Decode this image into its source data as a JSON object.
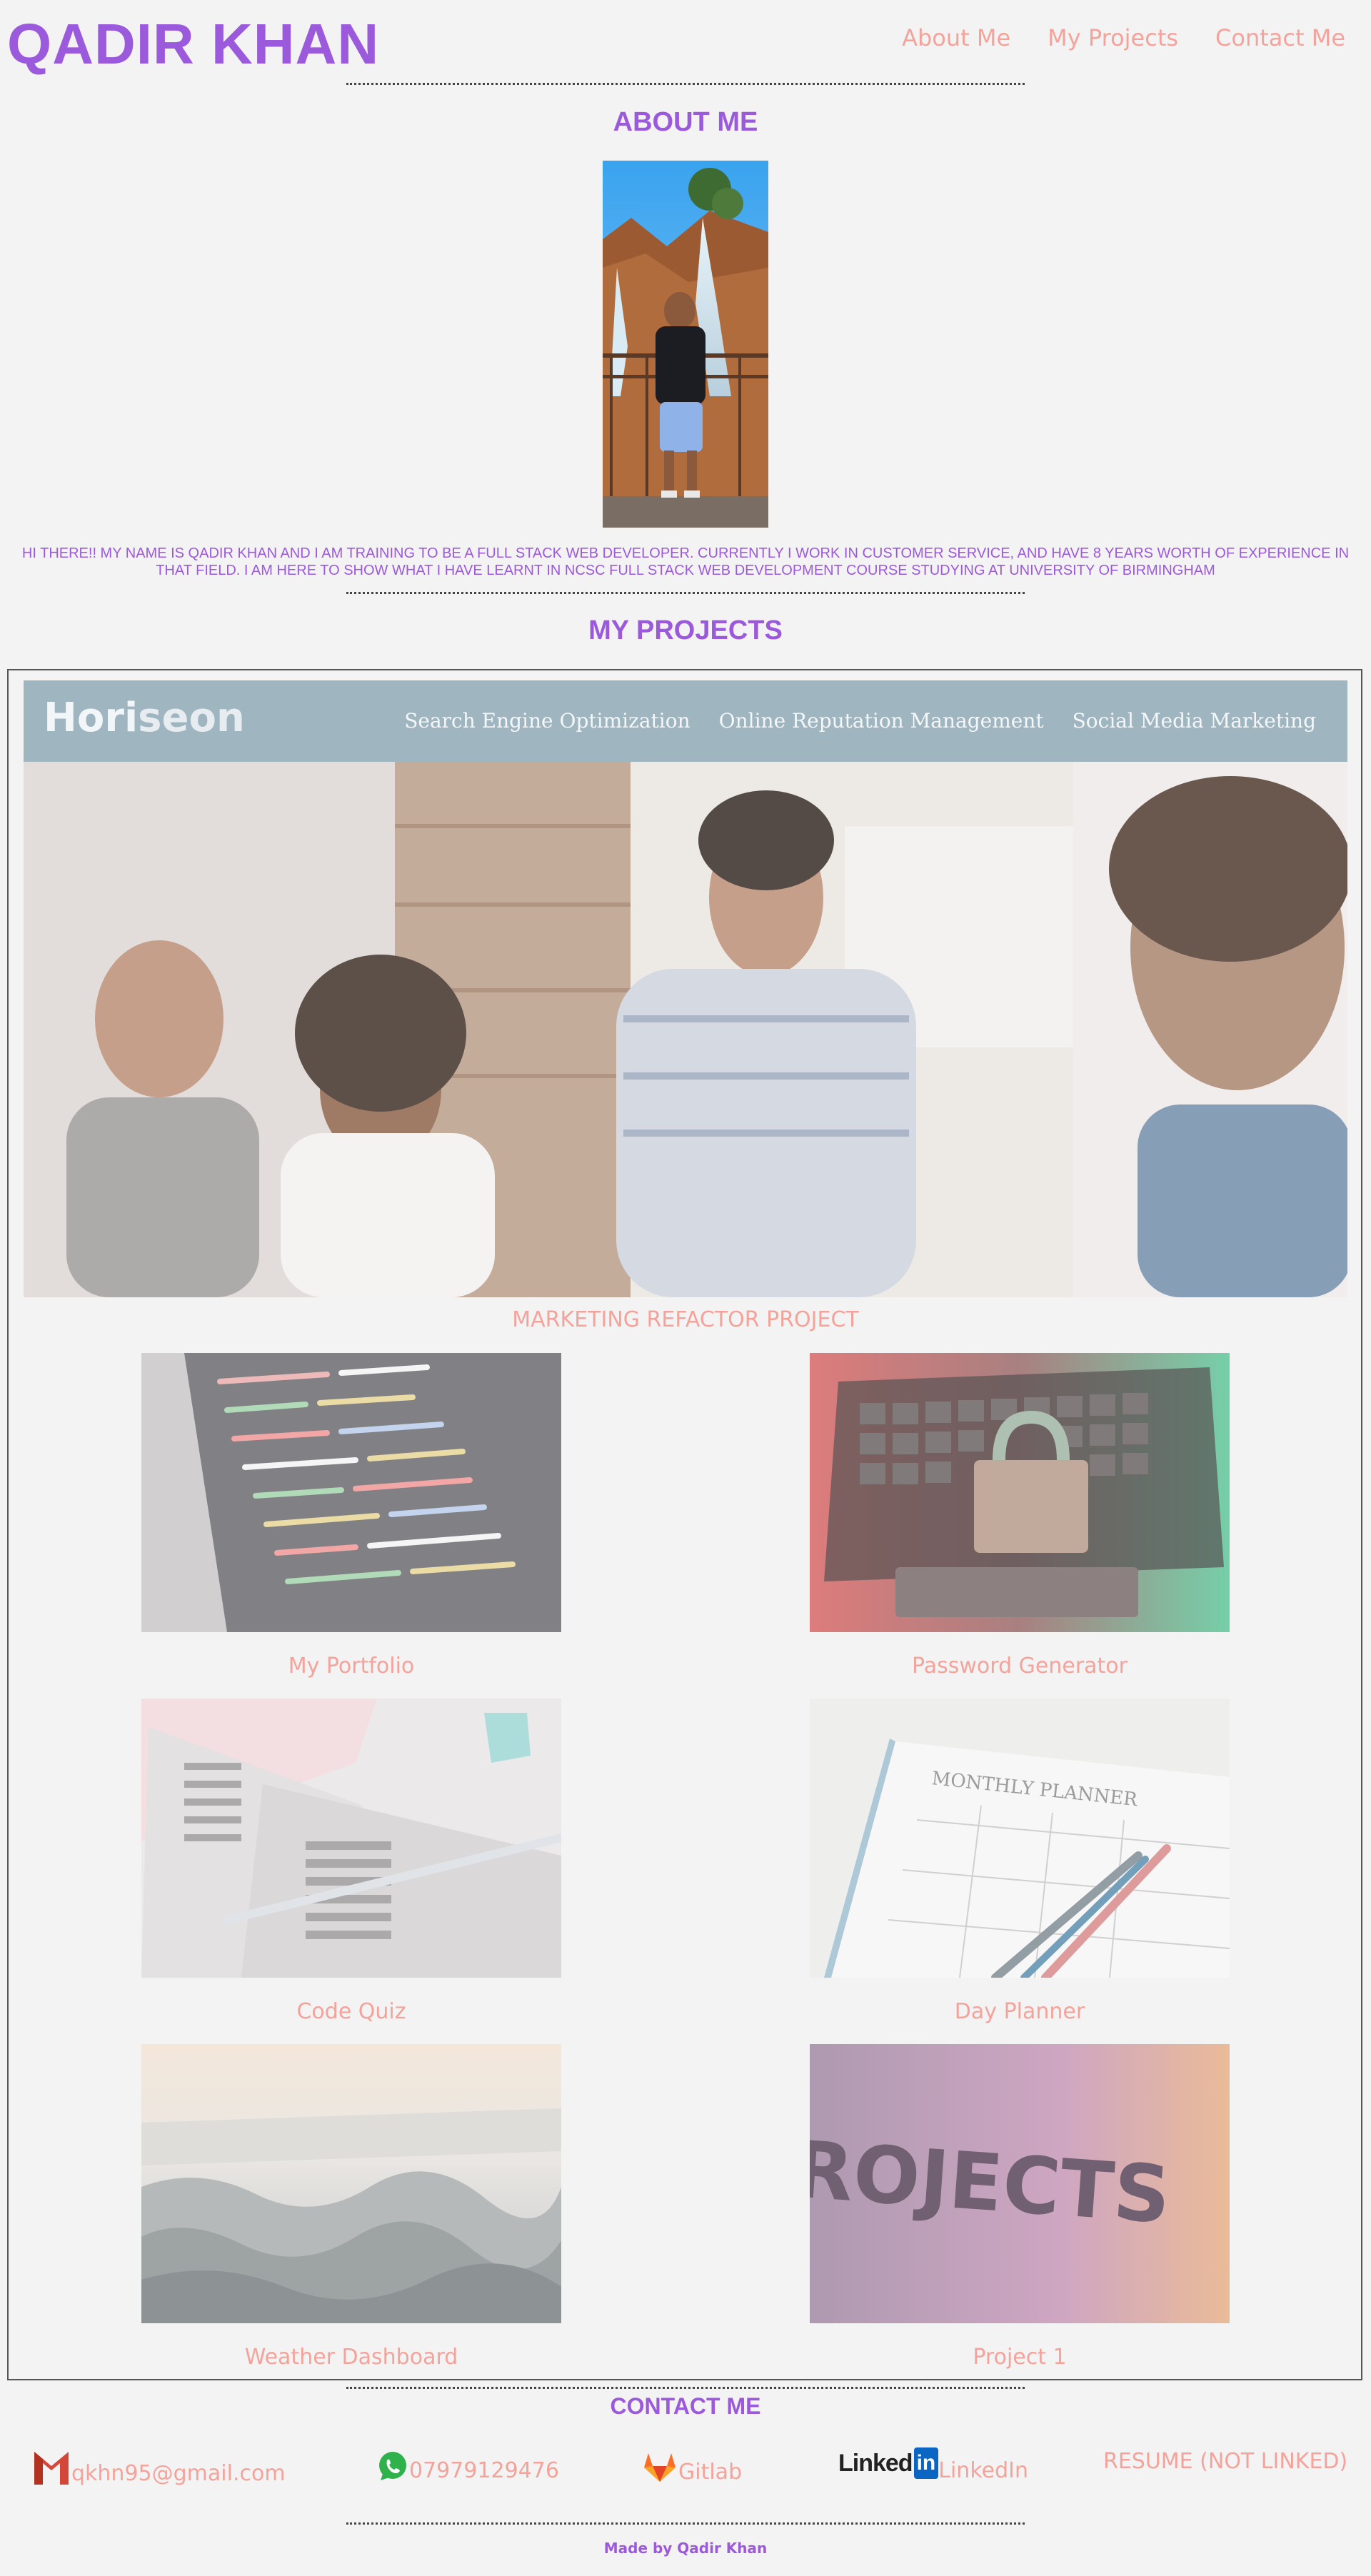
{
  "header": {
    "site_name": "QADIR KHAN",
    "nav": [
      "About Me",
      "My Projects",
      "Contact Me"
    ]
  },
  "about": {
    "title": "ABOUT ME",
    "text": "HI THERE!! MY NAME IS QADIR KHAN AND I AM TRAINING TO BE A FULL STACK WEB DEVELOPER. CURRENTLY I WORK IN CUSTOMER SERVICE, AND HAVE 8 YEARS WORTH OF EXPERIENCE IN THAT FIELD. I AM HERE TO SHOW WHAT I HAVE LEARNT IN NCSC FULL STACK WEB DEVELOPMENT COURSE STUDYING AT UNIVERSITY OF BIRMINGHAM"
  },
  "projects": {
    "title": "MY PROJECTS",
    "featured": {
      "logo_a": "Hori",
      "logo_b": "seon",
      "links": [
        "Search Engine Optimization",
        "Online Reputation Management",
        "Social Media Marketing"
      ],
      "label": "MARKETING REFACTOR PROJECT"
    },
    "items": [
      {
        "label": "My Portfolio"
      },
      {
        "label": "Password Generator"
      },
      {
        "label": "Code Quiz"
      },
      {
        "label": "Day Planner"
      },
      {
        "label": "Weather Dashboard"
      },
      {
        "label": "Project 1",
        "image_text": "PROJECTS"
      }
    ],
    "planner_text": "MONTHLY PLANNER"
  },
  "contact": {
    "title": "CONTACT ME",
    "email": "qkhn95@gmail.com",
    "phone": "07979129476",
    "gitlab": "Gitlab",
    "linkedin_logo_a": "Linked",
    "linkedin_logo_b": "in",
    "linkedin": "LinkedIn",
    "resume": "RESUME (NOT LINKED)"
  },
  "footer": {
    "text": "Made by Qadir Khan"
  },
  "colors": {
    "purple": "#9b59dc",
    "salmon": "#f4a39b",
    "background": "#f4f3f4"
  }
}
